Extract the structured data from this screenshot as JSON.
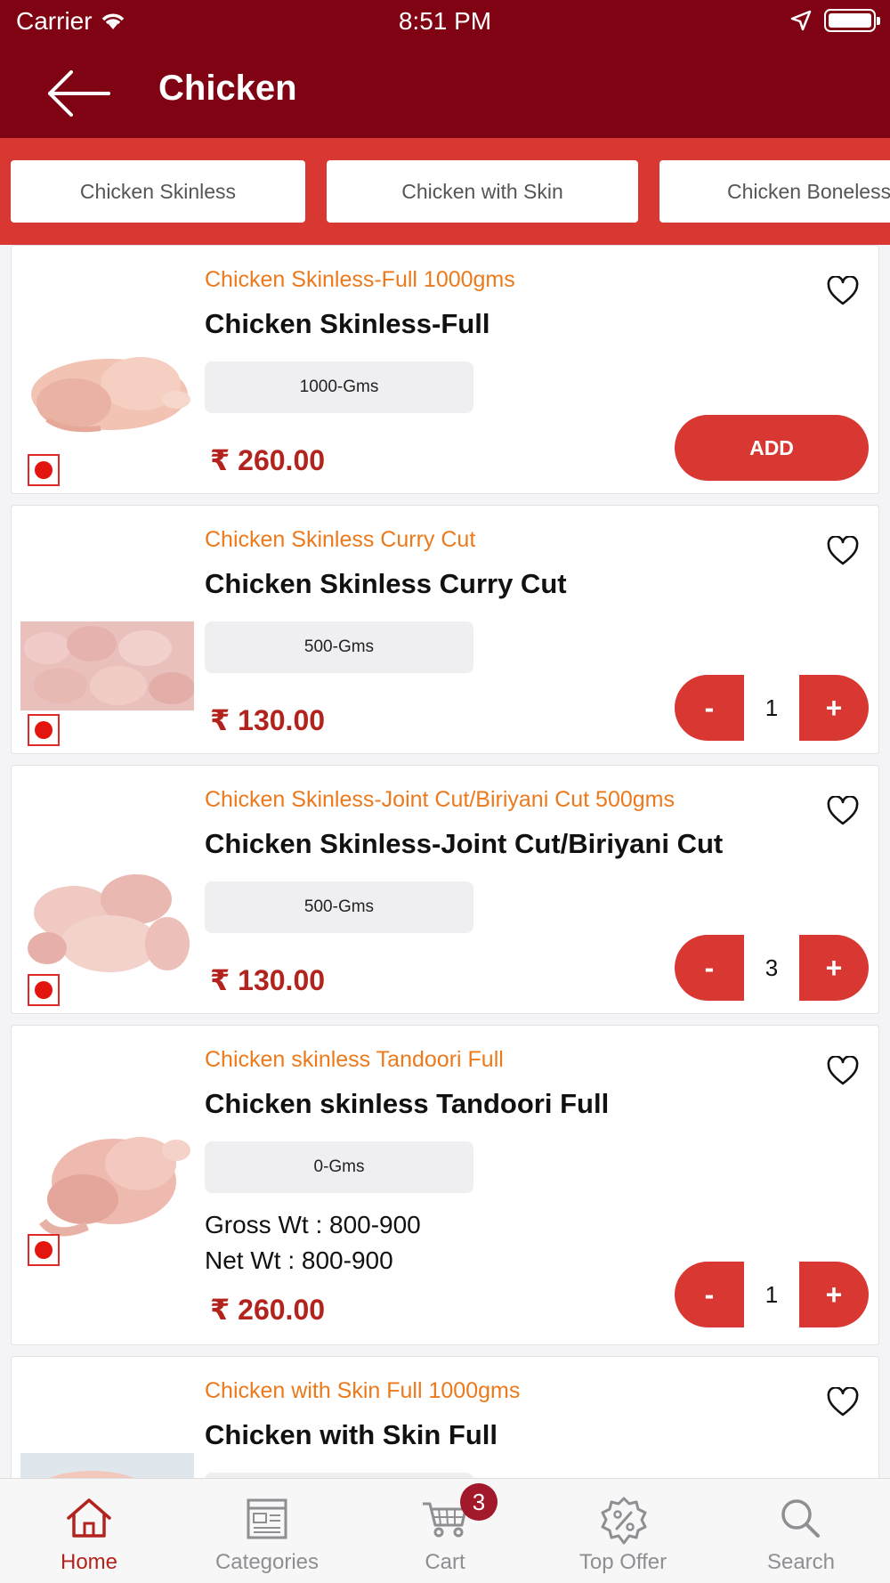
{
  "status_bar": {
    "carrier": "Carrier",
    "time": "8:51 PM"
  },
  "header": {
    "title": "Chicken",
    "background_color": "#800313"
  },
  "category_tabs": [
    {
      "label": "Chicken Skinless"
    },
    {
      "label": "Chicken with Skin"
    },
    {
      "label": "Chicken Boneless"
    }
  ],
  "products": [
    {
      "subtitle": "Chicken Skinless-Full 1000gms",
      "name": "Chicken Skinless-Full",
      "weight": "1000-Gms",
      "price": "₹ 260.00",
      "action": "add",
      "add_label": "ADD"
    },
    {
      "subtitle": "Chicken Skinless Curry Cut",
      "name": "Chicken Skinless Curry Cut",
      "weight": "500-Gms",
      "price": "₹ 130.00",
      "action": "stepper",
      "quantity": "1",
      "minus_label": "-",
      "plus_label": "+"
    },
    {
      "subtitle": "Chicken Skinless-Joint Cut/Biriyani Cut 500gms",
      "name": "Chicken Skinless-Joint Cut/Biriyani Cut",
      "weight": "500-Gms",
      "price": "₹ 130.00",
      "action": "stepper",
      "quantity": "3",
      "minus_label": "-",
      "plus_label": "+"
    },
    {
      "subtitle": "Chicken skinless Tandoori Full",
      "name": "Chicken skinless Tandoori Full",
      "weight": "0-Gms",
      "gross_wt": "Gross Wt : 800-900",
      "net_wt": "Net Wt : 800-900",
      "price": "₹ 260.00",
      "action": "stepper",
      "quantity": "1",
      "minus_label": "-",
      "plus_label": "+"
    },
    {
      "subtitle": "Chicken with Skin Full 1000gms",
      "name": "Chicken with Skin Full"
    }
  ],
  "tabbar": {
    "items": [
      {
        "label": "Home",
        "icon": "home-icon",
        "active": true
      },
      {
        "label": "Categories",
        "icon": "categories-icon"
      },
      {
        "label": "Cart",
        "icon": "cart-icon",
        "badge": "3"
      },
      {
        "label": "Top Offer",
        "icon": "offer-icon"
      },
      {
        "label": "Search",
        "icon": "search-icon"
      }
    ]
  },
  "colors": {
    "primary_dark": "#800313",
    "primary": "#d93732",
    "subtitle_orange": "#ec7a1c",
    "price_red": "#b3231e"
  }
}
